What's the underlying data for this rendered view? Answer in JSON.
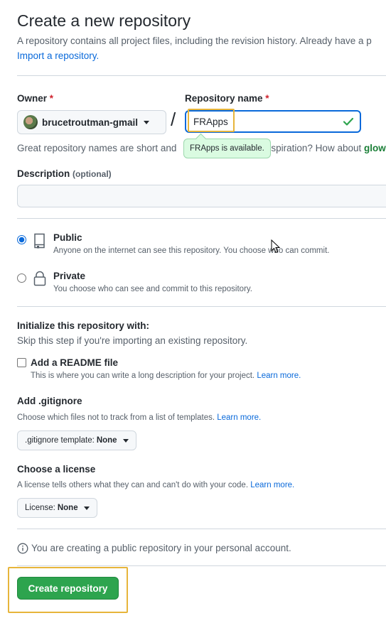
{
  "header": {
    "title": "Create a new repository",
    "intro": "A repository contains all project files, including the revision history. Already have a p",
    "import_link": "Import a repository."
  },
  "owner": {
    "label": "Owner",
    "required_mark": "*",
    "value": "brucetroutman-gmail"
  },
  "repo_name": {
    "label": "Repository name",
    "required_mark": "*",
    "value": "FRApps",
    "availability": "FRApps is available."
  },
  "separator": "/",
  "name_hint": {
    "text_before": "Great repository names are short and",
    "text_after": "nspiration? How about",
    "suggestion": "glow"
  },
  "description": {
    "label": "Description",
    "optional": "(optional)",
    "value": ""
  },
  "visibility": {
    "public": {
      "title": "Public",
      "description": "Anyone on the internet can see this repository. You choose who can commit.",
      "selected": true
    },
    "private": {
      "title": "Private",
      "description": "You choose who can see and commit to this repository.",
      "selected": false
    }
  },
  "initialize": {
    "title": "Initialize this repository with:",
    "subtitle": "Skip this step if you're importing an existing repository.",
    "readme": {
      "label": "Add a README file",
      "description": "This is where you can write a long description for your project.",
      "link": "Learn more.",
      "checked": false
    }
  },
  "gitignore": {
    "title": "Add .gitignore",
    "description": "Choose which files not to track from a list of templates.",
    "link": "Learn more.",
    "select_prefix": ".gitignore template:",
    "select_value": "None"
  },
  "license": {
    "title": "Choose a license",
    "description": "A license tells others what they can and can't do with your code.",
    "link": "Learn more.",
    "select_prefix": "License:",
    "select_value": "None"
  },
  "notice": "You are creating a public repository in your personal account.",
  "submit_label": "Create repository",
  "colors": {
    "accent_blue": "#0969da",
    "create_green": "#2da44e",
    "highlight_yellow": "#e7b53b",
    "required_red": "#cf222e"
  }
}
